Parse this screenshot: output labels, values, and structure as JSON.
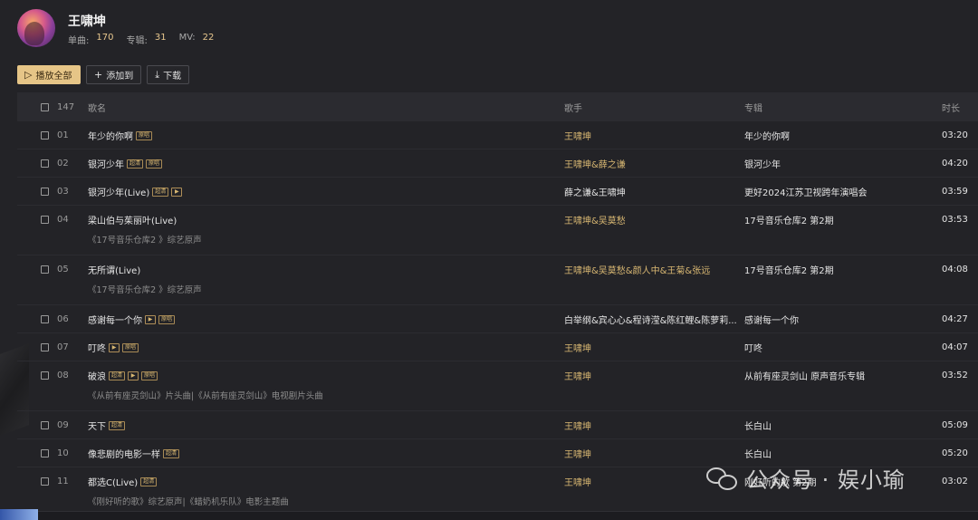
{
  "artist": {
    "name": "王啸坤",
    "stats": [
      {
        "label": "单曲:",
        "value": "170"
      },
      {
        "label": "专辑:",
        "value": "31"
      },
      {
        "label": "MV:",
        "value": "22"
      }
    ]
  },
  "toolbar": {
    "play_all": "播放全部",
    "add_to": "添加到",
    "download": "下载"
  },
  "table": {
    "count": "147",
    "headers": {
      "title": "歌名",
      "artist": "歌手",
      "album": "专辑",
      "duration": "时长"
    },
    "rows": [
      {
        "num": "01",
        "title": "年少的你啊",
        "tags": [
          "原唱"
        ],
        "mv": false,
        "artist": "王啸坤",
        "artist_style": "gold",
        "album": "年少的你啊",
        "duration": "03:20",
        "sub": ""
      },
      {
        "num": "02",
        "title": "银河少年",
        "tags": [
          "超清",
          "原唱"
        ],
        "mv": false,
        "artist": "王啸坤&薛之谦",
        "artist_style": "gold",
        "album": "银河少年",
        "duration": "04:20",
        "sub": ""
      },
      {
        "num": "03",
        "title": "银河少年(Live)",
        "tags": [
          "超清"
        ],
        "mv": true,
        "artist": "薛之谦&王啸坤",
        "artist_style": "white",
        "album": "更好2024江苏卫视跨年演唱会",
        "duration": "03:59",
        "sub": ""
      },
      {
        "num": "04",
        "title": "梁山伯与茱丽叶(Live)",
        "tags": [],
        "mv": false,
        "artist": "王啸坤&吴莫愁",
        "artist_style": "gold",
        "album": "17号音乐仓库2 第2期",
        "duration": "03:53",
        "sub": "《17号音乐仓库2 》综艺原声"
      },
      {
        "num": "05",
        "title": "无所谓(Live)",
        "tags": [],
        "mv": false,
        "artist": "王啸坤&吴莫愁&颜人中&王菊&张远",
        "artist_style": "gold",
        "album": "17号音乐仓库2 第2期",
        "duration": "04:08",
        "sub": "《17号音乐仓库2 》综艺原声"
      },
      {
        "num": "06",
        "title": "感谢每一个你",
        "tags": [],
        "mv": true,
        "tags_after": [
          "原唱"
        ],
        "artist": "白举纲&宾心心&程诗滢&陈红鲤&陈萝莉...",
        "artist_style": "white",
        "album": "感谢每一个你",
        "duration": "04:27",
        "sub": ""
      },
      {
        "num": "07",
        "title": "叮咚",
        "tags": [],
        "mv": true,
        "tags_after": [
          "原唱"
        ],
        "artist": "王啸坤",
        "artist_style": "gold",
        "album": "叮咚",
        "duration": "04:07",
        "sub": ""
      },
      {
        "num": "08",
        "title": "破浪",
        "tags": [
          "超清"
        ],
        "mv": true,
        "tags_after": [
          "原唱"
        ],
        "artist": "王啸坤",
        "artist_style": "gold",
        "album": "从前有座灵剑山 原声音乐专辑",
        "duration": "03:52",
        "sub": "《从前有座灵剑山》片头曲|《从前有座灵剑山》电视剧片头曲"
      },
      {
        "num": "09",
        "title": "天下",
        "tags": [
          "超清"
        ],
        "mv": false,
        "artist": "王啸坤",
        "artist_style": "gold",
        "album": "长白山",
        "duration": "05:09",
        "sub": ""
      },
      {
        "num": "10",
        "title": "像悲剧的电影一样",
        "tags": [
          "超清"
        ],
        "mv": false,
        "artist": "王啸坤",
        "artist_style": "gold",
        "album": "长白山",
        "duration": "05:20",
        "sub": ""
      },
      {
        "num": "11",
        "title": "都选C(Live)",
        "tags": [
          "超清"
        ],
        "mv": false,
        "artist": "王啸坤",
        "artist_style": "gold",
        "album": "刚好听的歌 第2期",
        "duration": "03:02",
        "sub": "《刚好听的歌》综艺原声|《蜡奶机乐队》电影主题曲"
      }
    ]
  },
  "watermark": "公众号 · 娱小瑜",
  "colors": {
    "accent": "#e6c587",
    "artist_link": "#d8b772",
    "background": "#232327"
  }
}
